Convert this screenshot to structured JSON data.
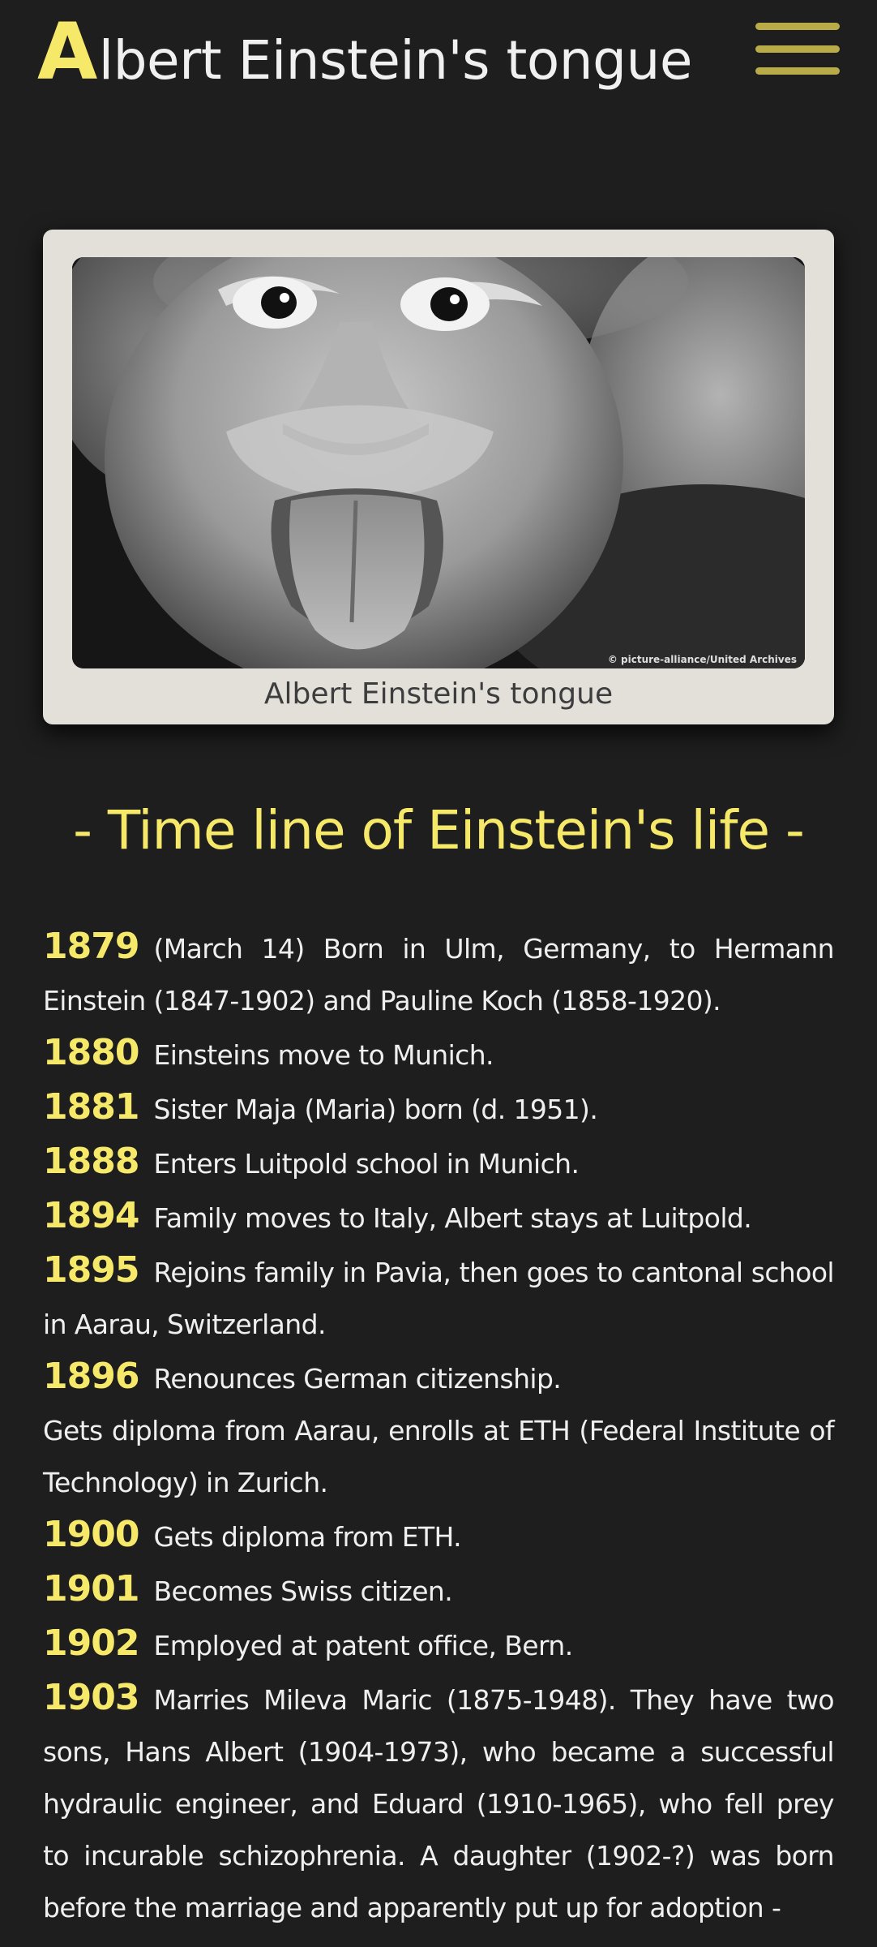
{
  "header": {
    "title_initial": "A",
    "title_rest": "lbert Einstein's tongue",
    "menu_icon": "hamburger-menu-icon"
  },
  "figure": {
    "credit": "© picture-alliance/United Archives",
    "caption": "Albert Einstein's tongue"
  },
  "timeline": {
    "heading": "- Time line of Einstein's life -",
    "entries": [
      {
        "year": "1879",
        "text": "(March 14) Born in Ulm, Germany, to Hermann Einstein (1847-1902) and Pauline Koch (1858-1920)."
      },
      {
        "year": "1880",
        "text": "Einsteins move to Munich."
      },
      {
        "year": "1881",
        "text": "Sister Maja (Maria) born (d. 1951)."
      },
      {
        "year": "1888",
        "text": "Enters Luitpold school in Munich."
      },
      {
        "year": "1894",
        "text": "Family moves to Italy, Albert stays at Luitpold."
      },
      {
        "year": "1895",
        "text": "Rejoins family in Pavia, then goes to cantonal school in Aarau, Switzerland."
      },
      {
        "year": "1896",
        "text": "Renounces German citizenship."
      },
      {
        "year": "",
        "text": "Gets diploma from Aarau, enrolls at ETH (Federal Institute of Technology) in Zurich."
      },
      {
        "year": "1900",
        "text": "Gets diploma from ETH."
      },
      {
        "year": "1901",
        "text": "Becomes Swiss citizen."
      },
      {
        "year": "1902",
        "text": "Employed at patent office, Bern."
      },
      {
        "year": "1903",
        "text": "Marries Mileva Maric (1875-1948). They have two sons, Hans Albert (1904-1973), who became a successful hydraulic engineer, and Eduard (1910-1965), who fell prey to incurable schizophrenia. A daughter (1902-?) was born before the marriage and apparently put up for adoption -"
      }
    ]
  },
  "colors": {
    "background": "#1e1e1e",
    "accent": "#f6e96a",
    "menu": "#b8ab48",
    "card": "#e3e0da"
  }
}
